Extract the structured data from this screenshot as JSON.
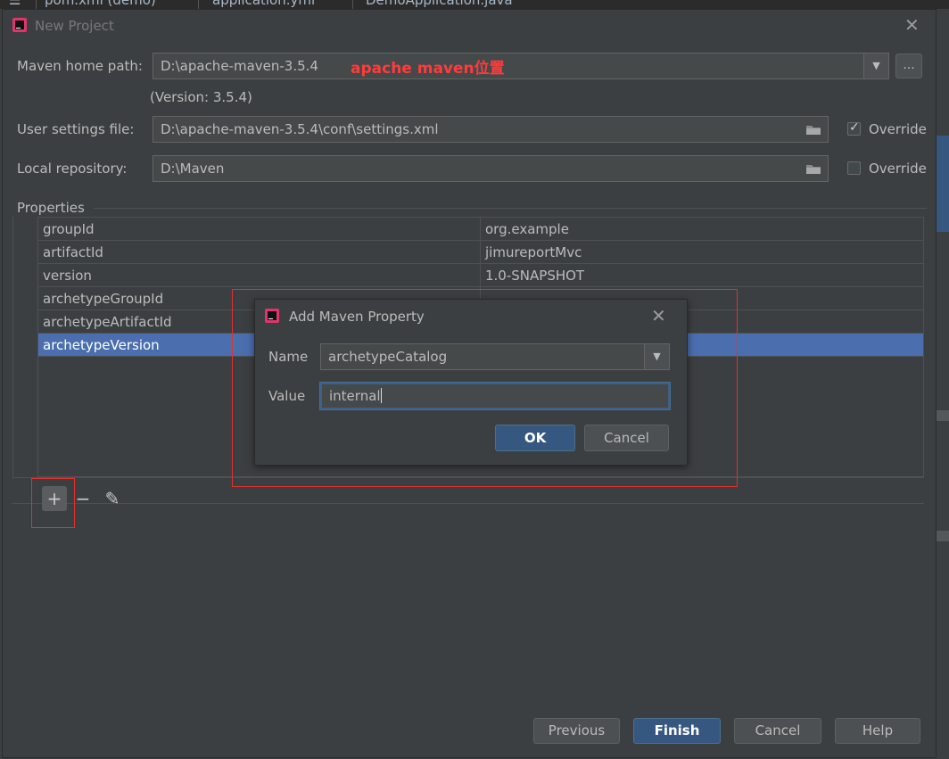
{
  "ide_tabs": [
    "pom.xml (demo)",
    "application.yml",
    "DemoApplication.java"
  ],
  "window": {
    "title": "New Project"
  },
  "form": {
    "maven_home_label": "Maven home path:",
    "maven_home_value": "D:\\apache-maven-3.5.4",
    "maven_home_annotation": "apache maven位置",
    "browse_label": "...",
    "version_text": "(Version: 3.5.4)",
    "user_settings_label": "User settings file:",
    "user_settings_value": "D:\\apache-maven-3.5.4\\conf\\settings.xml",
    "user_settings_override": "Override",
    "user_settings_override_checked": true,
    "local_repo_label": "Local repository:",
    "local_repo_value": "D:\\Maven",
    "local_repo_override": "Override",
    "local_repo_override_checked": false
  },
  "properties": {
    "section_label": "Properties",
    "rows": [
      {
        "key": "groupId",
        "value": "org.example"
      },
      {
        "key": "artifactId",
        "value": "jimureportMvc"
      },
      {
        "key": "version",
        "value": "1.0-SNAPSHOT"
      },
      {
        "key": "archetypeGroupId",
        "value": ""
      },
      {
        "key": "archetypeArtifactId",
        "value": ""
      },
      {
        "key": "archetypeVersion",
        "value": ""
      }
    ],
    "selected_index": 5,
    "toolbar": {
      "add_label": "+",
      "remove_label": "−",
      "edit_label": "✎"
    }
  },
  "dialog": {
    "title": "Add Maven Property",
    "name_label": "Name",
    "name_value": "archetypeCatalog",
    "value_label": "Value",
    "value_value": "internal",
    "ok_label": "OK",
    "cancel_label": "Cancel"
  },
  "footer": {
    "previous_label": "Previous",
    "finish_label": "Finish",
    "cancel_label": "Cancel",
    "help_label": "Help"
  },
  "colors": {
    "background": "#3c3f41",
    "selection": "#4b6eaf",
    "primary_button": "#365880",
    "annotation_red": "#ff3b3b"
  }
}
